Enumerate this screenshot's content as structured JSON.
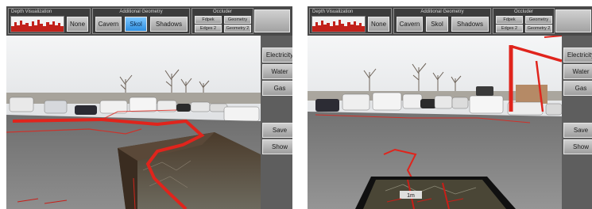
{
  "panels": [
    {
      "depth": {
        "title": "Depth Visualization",
        "none": "None"
      },
      "geometry": {
        "title": "Additional Geometry",
        "buttons": [
          "Cavern",
          "Skol",
          "Shadows"
        ],
        "active": "Skol"
      },
      "occluder": {
        "title": "Occluder",
        "buttons": [
          "Fdpek",
          "Geometry",
          "Edges 2",
          "Geometry 2"
        ]
      },
      "side_top": [
        "Electricity",
        "Water",
        "Gas"
      ],
      "side_bottom": [
        "Save",
        "Show"
      ]
    },
    {
      "depth": {
        "title": "Depth Visualization",
        "none": "None"
      },
      "geometry": {
        "title": "Additional Geometry",
        "buttons": [
          "Cavern",
          "Skol",
          "Shadows"
        ],
        "active": ""
      },
      "occluder": {
        "title": "Occluder",
        "buttons": [
          "Fdpek",
          "Geometry",
          "Edges 2",
          "Geometry 2"
        ]
      },
      "side_top": [
        "Electricity",
        "Water",
        "Gas"
      ],
      "side_bottom": [
        "Save",
        "Show"
      ],
      "scale_label": "1m"
    }
  ],
  "colors": {
    "pipe": "#e0241c",
    "accent_active": "#2f8fe0"
  }
}
